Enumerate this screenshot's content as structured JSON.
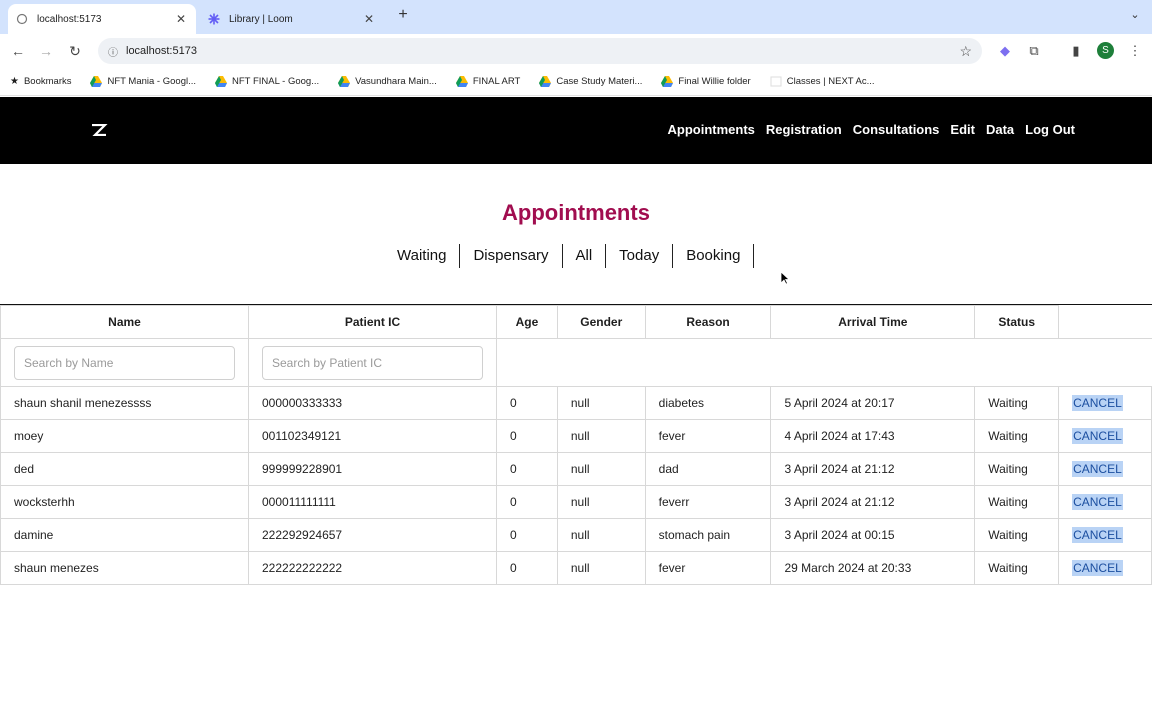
{
  "browser": {
    "tabs": [
      {
        "title": "localhost:5173",
        "active": true
      },
      {
        "title": "Library | Loom",
        "active": false
      }
    ],
    "url": "localhost:5173",
    "profile_initial": "S",
    "bookmarks_label": "Bookmarks",
    "bookmarks": [
      "NFT Mania - Googl...",
      "NFT FINAL - Goog...",
      "Vasundhara Main...",
      "FINAL ART",
      "Case Study Materi...",
      "Final Willie folder",
      "Classes | NEXT Ac..."
    ]
  },
  "app": {
    "nav": [
      "Appointments",
      "Registration",
      "Consultations",
      "Edit",
      "Data",
      "Log Out"
    ],
    "page_title": "Appointments",
    "filters": [
      "Waiting",
      "Dispensary",
      "All",
      "Today",
      "Booking"
    ],
    "columns": [
      "Name",
      "Patient IC",
      "Age",
      "Gender",
      "Reason",
      "Arrival Time",
      "Status"
    ],
    "search": {
      "name_placeholder": "Search by Name",
      "ic_placeholder": "Search by Patient IC"
    },
    "rows": [
      {
        "name": "shaun shanil menezessss",
        "ic": "000000333333",
        "age": "0",
        "gender": "null",
        "reason": "diabetes",
        "arrival": "5 April 2024 at 20:17",
        "status": "Waiting",
        "action": "CANCEL"
      },
      {
        "name": "moey",
        "ic": "001102349121",
        "age": "0",
        "gender": "null",
        "reason": "fever",
        "arrival": "4 April 2024 at 17:43",
        "status": "Waiting",
        "action": "CANCEL"
      },
      {
        "name": "ded",
        "ic": "999999228901",
        "age": "0",
        "gender": "null",
        "reason": "dad",
        "arrival": "3 April 2024 at 21:12",
        "status": "Waiting",
        "action": "CANCEL"
      },
      {
        "name": "wocksterhh",
        "ic": "000011111111",
        "age": "0",
        "gender": "null",
        "reason": "feverr",
        "arrival": "3 April 2024 at 21:12",
        "status": "Waiting",
        "action": "CANCEL"
      },
      {
        "name": "damine",
        "ic": "222292924657",
        "age": "0",
        "gender": "null",
        "reason": "stomach pain",
        "arrival": "3 April 2024 at 00:15",
        "status": "Waiting",
        "action": "CANCEL"
      },
      {
        "name": "shaun menezes",
        "ic": "222222222222",
        "age": "0",
        "gender": "null",
        "reason": "fever",
        "arrival": "29 March 2024 at 20:33",
        "status": "Waiting",
        "action": "CANCEL"
      }
    ]
  },
  "colors": {
    "title_accent": "#a10d4f",
    "nav_bg": "#000000",
    "cancel_highlight": "#b9d3f5"
  }
}
